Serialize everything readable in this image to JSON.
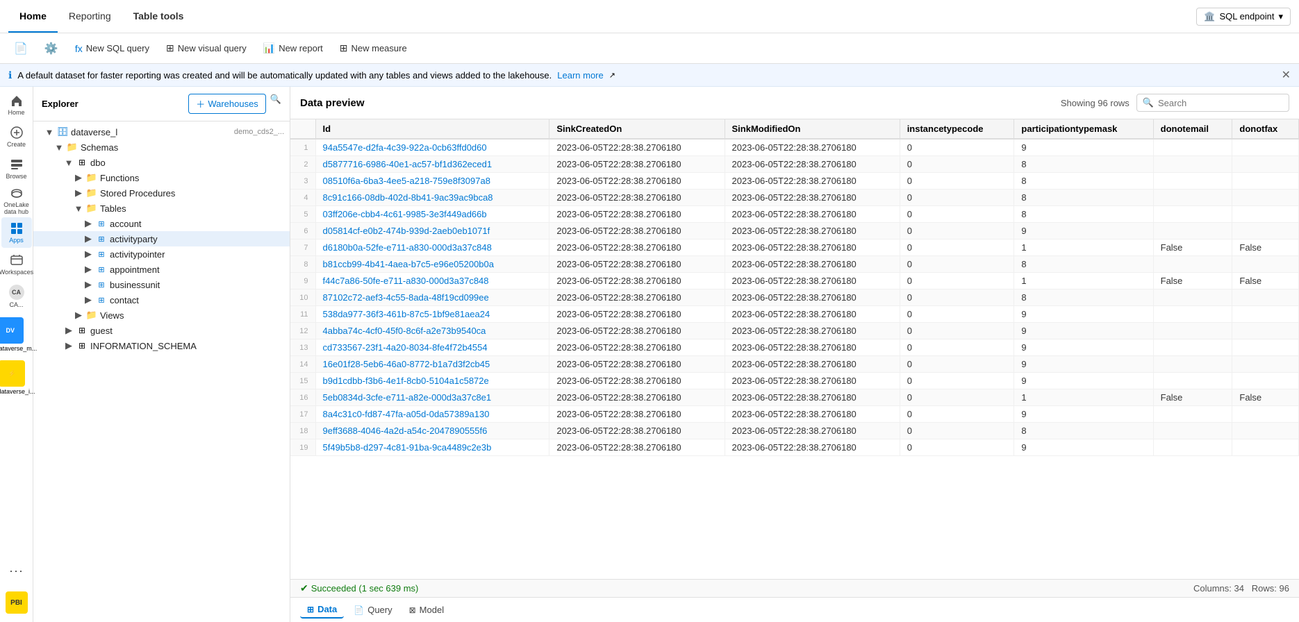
{
  "tabs": {
    "home": "Home",
    "reporting": "Reporting",
    "table_tools": "Table tools"
  },
  "sql_endpoint": "SQL endpoint",
  "toolbar": {
    "new_sql_query": "New SQL query",
    "new_visual_query": "New visual query",
    "new_report": "New report",
    "new_measure": "New measure"
  },
  "info_bar": {
    "message": "A default dataset for faster reporting was created and will be automatically updated with any tables and views added to the lakehouse.",
    "learn_more": "Learn more"
  },
  "sidebar": {
    "home_label": "Home",
    "create_label": "Create",
    "browse_label": "Browse",
    "onelake_label": "OneLake data hub",
    "apps_label": "Apps",
    "workspaces_label": "Workspaces",
    "ca_label": "CA...",
    "dataverse_m_label": "dataverse_m...",
    "dataverse_i_label": "dataverse_i..."
  },
  "explorer": {
    "title": "Explorer",
    "add_btn": "Warehouses",
    "db_name": "dataverse_l",
    "db_subtitle": "demo_cds2_...",
    "schemas_label": "Schemas",
    "dbo_label": "dbo",
    "functions_label": "Functions",
    "stored_procedures_label": "Stored Procedures",
    "tables_label": "Tables",
    "account_label": "account",
    "activityparty_label": "activityparty",
    "activitypointer_label": "activitypointer",
    "appointment_label": "appointment",
    "businessunit_label": "businessunit",
    "contact_label": "contact",
    "views_label": "Views",
    "guest_label": "guest",
    "information_schema_label": "INFORMATION_SCHEMA"
  },
  "preview": {
    "title": "Data preview",
    "showing_rows": "Showing 96 rows",
    "search_placeholder": "Search",
    "columns": [
      "Id",
      "SinkCreatedOn",
      "SinkModifiedOn",
      "instancetypecode",
      "participationtypemask",
      "donotemail",
      "donotfax"
    ],
    "rows": [
      {
        "num": 1,
        "id": "94a5547e-d2fa-4c39-922a-0cb63ffd0d60",
        "sink_created": "2023-06-05T22:28:38.2706180",
        "sink_modified": "2023-06-05T22:28:38.2706180",
        "instance": "0",
        "participation": "9",
        "donotemail": "",
        "donotfax": ""
      },
      {
        "num": 2,
        "id": "d5877716-6986-40e1-ac57-bf1d362eced1",
        "sink_created": "2023-06-05T22:28:38.2706180",
        "sink_modified": "2023-06-05T22:28:38.2706180",
        "instance": "0",
        "participation": "8",
        "donotemail": "",
        "donotfax": ""
      },
      {
        "num": 3,
        "id": "08510f6a-6ba3-4ee5-a218-759e8f3097a8",
        "sink_created": "2023-06-05T22:28:38.2706180",
        "sink_modified": "2023-06-05T22:28:38.2706180",
        "instance": "0",
        "participation": "8",
        "donotemail": "",
        "donotfax": ""
      },
      {
        "num": 4,
        "id": "8c91c166-08db-402d-8b41-9ac39ac9bca8",
        "sink_created": "2023-06-05T22:28:38.2706180",
        "sink_modified": "2023-06-05T22:28:38.2706180",
        "instance": "0",
        "participation": "8",
        "donotemail": "",
        "donotfax": ""
      },
      {
        "num": 5,
        "id": "03ff206e-cbb4-4c61-9985-3e3f449ad66b",
        "sink_created": "2023-06-05T22:28:38.2706180",
        "sink_modified": "2023-06-05T22:28:38.2706180",
        "instance": "0",
        "participation": "8",
        "donotemail": "",
        "donotfax": ""
      },
      {
        "num": 6,
        "id": "d05814cf-e0b2-474b-939d-2aeb0eb1071f",
        "sink_created": "2023-06-05T22:28:38.2706180",
        "sink_modified": "2023-06-05T22:28:38.2706180",
        "instance": "0",
        "participation": "9",
        "donotemail": "",
        "donotfax": ""
      },
      {
        "num": 7,
        "id": "d6180b0a-52fe-e711-a830-000d3a37c848",
        "sink_created": "2023-06-05T22:28:38.2706180",
        "sink_modified": "2023-06-05T22:28:38.2706180",
        "instance": "0",
        "participation": "1",
        "donotemail": "False",
        "donotfax": "False"
      },
      {
        "num": 8,
        "id": "b81ccb99-4b41-4aea-b7c5-e96e05200b0a",
        "sink_created": "2023-06-05T22:28:38.2706180",
        "sink_modified": "2023-06-05T22:28:38.2706180",
        "instance": "0",
        "participation": "8",
        "donotemail": "",
        "donotfax": ""
      },
      {
        "num": 9,
        "id": "f44c7a86-50fe-e711-a830-000d3a37c848",
        "sink_created": "2023-06-05T22:28:38.2706180",
        "sink_modified": "2023-06-05T22:28:38.2706180",
        "instance": "0",
        "participation": "1",
        "donotemail": "False",
        "donotfax": "False"
      },
      {
        "num": 10,
        "id": "87102c72-aef3-4c55-8ada-48f19cd099ee",
        "sink_created": "2023-06-05T22:28:38.2706180",
        "sink_modified": "2023-06-05T22:28:38.2706180",
        "instance": "0",
        "participation": "8",
        "donotemail": "",
        "donotfax": ""
      },
      {
        "num": 11,
        "id": "538da977-36f3-461b-87c5-1bf9e81aea24",
        "sink_created": "2023-06-05T22:28:38.2706180",
        "sink_modified": "2023-06-05T22:28:38.2706180",
        "instance": "0",
        "participation": "9",
        "donotemail": "",
        "donotfax": ""
      },
      {
        "num": 12,
        "id": "4abba74c-4cf0-45f0-8c6f-a2e73b9540ca",
        "sink_created": "2023-06-05T22:28:38.2706180",
        "sink_modified": "2023-06-05T22:28:38.2706180",
        "instance": "0",
        "participation": "9",
        "donotemail": "",
        "donotfax": ""
      },
      {
        "num": 13,
        "id": "cd733567-23f1-4a20-8034-8fe4f72b4554",
        "sink_created": "2023-06-05T22:28:38.2706180",
        "sink_modified": "2023-06-05T22:28:38.2706180",
        "instance": "0",
        "participation": "9",
        "donotemail": "",
        "donotfax": ""
      },
      {
        "num": 14,
        "id": "16e01f28-5eb6-46a0-8772-b1a7d3f2cb45",
        "sink_created": "2023-06-05T22:28:38.2706180",
        "sink_modified": "2023-06-05T22:28:38.2706180",
        "instance": "0",
        "participation": "9",
        "donotemail": "",
        "donotfax": ""
      },
      {
        "num": 15,
        "id": "b9d1cdbb-f3b6-4e1f-8cb0-5104a1c5872e",
        "sink_created": "2023-06-05T22:28:38.2706180",
        "sink_modified": "2023-06-05T22:28:38.2706180",
        "instance": "0",
        "participation": "9",
        "donotemail": "",
        "donotfax": ""
      },
      {
        "num": 16,
        "id": "5eb0834d-3cfe-e711-a82e-000d3a37c8e1",
        "sink_created": "2023-06-05T22:28:38.2706180",
        "sink_modified": "2023-06-05T22:28:38.2706180",
        "instance": "0",
        "participation": "1",
        "donotemail": "False",
        "donotfax": "False"
      },
      {
        "num": 17,
        "id": "8a4c31c0-fd87-47fa-a05d-0da57389a130",
        "sink_created": "2023-06-05T22:28:38.2706180",
        "sink_modified": "2023-06-05T22:28:38.2706180",
        "instance": "0",
        "participation": "9",
        "donotemail": "",
        "donotfax": ""
      },
      {
        "num": 18,
        "id": "9eff3688-4046-4a2d-a54c-2047890555f6",
        "sink_created": "2023-06-05T22:28:38.2706180",
        "sink_modified": "2023-06-05T22:28:38.2706180",
        "instance": "0",
        "participation": "8",
        "donotemail": "",
        "donotfax": ""
      },
      {
        "num": 19,
        "id": "5f49b5b8-d297-4c81-91ba-9ca4489c2e3b",
        "sink_created": "2023-06-05T22:28:38.2706180",
        "sink_modified": "2023-06-05T22:28:38.2706180",
        "instance": "0",
        "participation": "9",
        "donotemail": "",
        "donotfax": ""
      }
    ],
    "status": "Succeeded (1 sec 639 ms)",
    "columns_count": "Columns: 34",
    "rows_count": "Rows: 96"
  },
  "bottom_tabs": {
    "data": "Data",
    "query": "Query",
    "model": "Model"
  }
}
